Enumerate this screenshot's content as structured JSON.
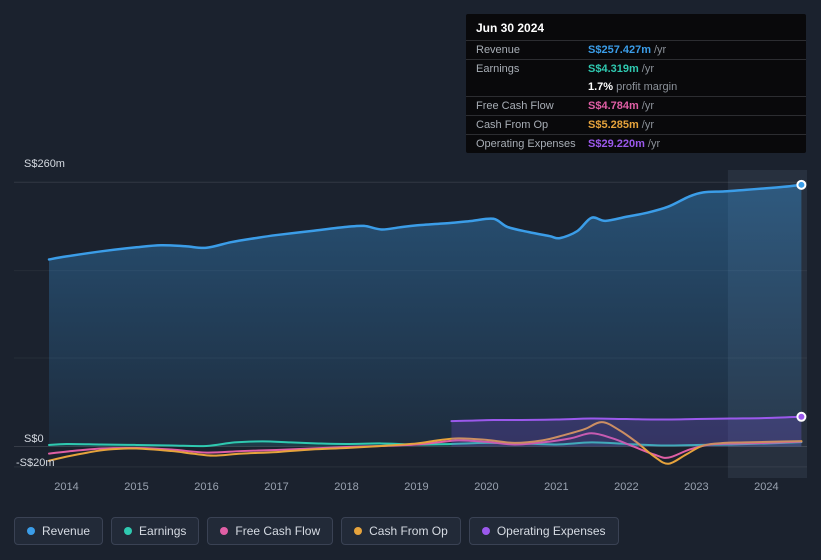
{
  "tooltip": {
    "date": "Jun 30 2024",
    "rows": {
      "revenue": {
        "label": "Revenue",
        "value": "S$257.427m",
        "suffix": "/yr"
      },
      "earnings": {
        "label": "Earnings",
        "value": "S$4.319m",
        "suffix": "/yr"
      },
      "margin": {
        "value": "1.7%",
        "suffix": "profit margin"
      },
      "fcf": {
        "label": "Free Cash Flow",
        "value": "S$4.784m",
        "suffix": "/yr"
      },
      "cash_op": {
        "label": "Cash From Op",
        "value": "S$5.285m",
        "suffix": "/yr"
      },
      "opex": {
        "label": "Operating Expenses",
        "value": "S$29.220m",
        "suffix": "/yr"
      }
    }
  },
  "chart_data": {
    "type": "line",
    "unit": "S$m",
    "xlim": [
      2013.25,
      2024.58
    ],
    "ylim": [
      -31,
      272
    ],
    "x_ticks": [
      2014,
      2015,
      2016,
      2017,
      2018,
      2019,
      2020,
      2021,
      2022,
      2023,
      2024
    ],
    "y_ticks": [
      {
        "label": "S$260m",
        "value": 260
      },
      {
        "label": "S$0",
        "value": 0
      },
      {
        "label": "-S$20m",
        "value": -20
      }
    ],
    "grid": [
      {
        "v": 260,
        "o": 0.1
      },
      {
        "v": 173,
        "o": 0.05
      },
      {
        "v": 87,
        "o": 0.05
      },
      {
        "v": 0,
        "o": 0.12
      },
      {
        "v": -20,
        "o": 0.07
      }
    ],
    "highlight": {
      "x0": 2023.45,
      "x1": 2024.58
    },
    "legend_position": "bottom",
    "series": [
      {
        "name": "Revenue",
        "slug": "revenue",
        "color": "#3b9de8",
        "width": 2.5,
        "fill": "gradient",
        "end_dot": true,
        "points": [
          [
            2013.75,
            184
          ],
          [
            2014,
            187
          ],
          [
            2014.5,
            192
          ],
          [
            2015,
            196
          ],
          [
            2015.35,
            198
          ],
          [
            2015.7,
            197
          ],
          [
            2016,
            195.5
          ],
          [
            2016.35,
            201
          ],
          [
            2016.7,
            205
          ],
          [
            2017,
            208
          ],
          [
            2017.5,
            212
          ],
          [
            2018,
            216
          ],
          [
            2018.25,
            217
          ],
          [
            2018.5,
            213.5
          ],
          [
            2018.75,
            215.5
          ],
          [
            2019,
            217.5
          ],
          [
            2019.5,
            220
          ],
          [
            2019.8,
            222
          ],
          [
            2020.1,
            224
          ],
          [
            2020.3,
            216
          ],
          [
            2020.6,
            211
          ],
          [
            2020.9,
            207
          ],
          [
            2021.05,
            205
          ],
          [
            2021.3,
            212
          ],
          [
            2021.5,
            225
          ],
          [
            2021.7,
            222
          ],
          [
            2022,
            226
          ],
          [
            2022.3,
            230
          ],
          [
            2022.6,
            236
          ],
          [
            2022.9,
            246
          ],
          [
            2023.1,
            250
          ],
          [
            2023.4,
            251
          ],
          [
            2023.7,
            252.5
          ],
          [
            2024,
            254
          ],
          [
            2024.25,
            255.5
          ],
          [
            2024.5,
            257.427
          ]
        ]
      },
      {
        "name": "Earnings",
        "slug": "earnings",
        "color": "#2fc9b0",
        "width": 2,
        "fill": "rgba(47,201,176,0.10)",
        "end_dot": false,
        "points": [
          [
            2013.75,
            1.5
          ],
          [
            2014,
            2.5
          ],
          [
            2014.5,
            2
          ],
          [
            2015,
            1.5
          ],
          [
            2015.5,
            1
          ],
          [
            2016,
            0.5
          ],
          [
            2016.4,
            4
          ],
          [
            2016.8,
            5
          ],
          [
            2017.2,
            4
          ],
          [
            2017.6,
            3
          ],
          [
            2018,
            2.5
          ],
          [
            2018.5,
            3
          ],
          [
            2019,
            2
          ],
          [
            2019.5,
            2.5
          ],
          [
            2020,
            3.5
          ],
          [
            2020.5,
            3
          ],
          [
            2021,
            2
          ],
          [
            2021.5,
            4
          ],
          [
            2022,
            2.5
          ],
          [
            2022.5,
            1
          ],
          [
            2023,
            1.5
          ],
          [
            2023.5,
            2
          ],
          [
            2024,
            3
          ],
          [
            2024.5,
            4.319
          ]
        ]
      },
      {
        "name": "Free Cash Flow",
        "slug": "free-cash-flow",
        "color": "#e05fa5",
        "width": 2,
        "fill": null,
        "end_dot": false,
        "points": [
          [
            2013.75,
            -7
          ],
          [
            2014,
            -5
          ],
          [
            2014.5,
            -2
          ],
          [
            2015,
            -1.5
          ],
          [
            2015.5,
            -3
          ],
          [
            2016,
            -6
          ],
          [
            2016.5,
            -4.5
          ],
          [
            2017,
            -3.5
          ],
          [
            2017.5,
            -2
          ],
          [
            2018,
            -0.5
          ],
          [
            2018.5,
            0.5
          ],
          [
            2019,
            2
          ],
          [
            2019.3,
            4
          ],
          [
            2019.6,
            6
          ],
          [
            2020,
            4.5
          ],
          [
            2020.4,
            2
          ],
          [
            2020.8,
            4
          ],
          [
            2021.2,
            8
          ],
          [
            2021.5,
            13
          ],
          [
            2021.8,
            8
          ],
          [
            2022.1,
            0
          ],
          [
            2022.4,
            -8
          ],
          [
            2022.6,
            -11
          ],
          [
            2022.9,
            -3
          ],
          [
            2023.2,
            2
          ],
          [
            2023.6,
            3
          ],
          [
            2024,
            3.5
          ],
          [
            2024.5,
            4.784
          ]
        ]
      },
      {
        "name": "Cash From Op",
        "slug": "cash-from-op",
        "color": "#e6a33c",
        "width": 2,
        "fill": null,
        "end_dot": false,
        "points": [
          [
            2013.75,
            -14
          ],
          [
            2014,
            -10
          ],
          [
            2014.3,
            -6
          ],
          [
            2014.6,
            -3
          ],
          [
            2015,
            -2
          ],
          [
            2015.5,
            -4.5
          ],
          [
            2015.8,
            -7
          ],
          [
            2016.1,
            -9
          ],
          [
            2016.5,
            -7
          ],
          [
            2017,
            -5.5
          ],
          [
            2017.5,
            -3
          ],
          [
            2018,
            -1.5
          ],
          [
            2018.5,
            0.5
          ],
          [
            2019,
            3
          ],
          [
            2019.3,
            6
          ],
          [
            2019.6,
            8
          ],
          [
            2020,
            6.5
          ],
          [
            2020.4,
            3.5
          ],
          [
            2020.8,
            6
          ],
          [
            2021.1,
            11
          ],
          [
            2021.4,
            17
          ],
          [
            2021.65,
            24
          ],
          [
            2021.9,
            16
          ],
          [
            2022.15,
            4
          ],
          [
            2022.4,
            -10
          ],
          [
            2022.6,
            -17
          ],
          [
            2022.85,
            -8
          ],
          [
            2023.1,
            1
          ],
          [
            2023.4,
            3.5
          ],
          [
            2023.7,
            4
          ],
          [
            2024,
            4.5
          ],
          [
            2024.5,
            5.285
          ]
        ]
      },
      {
        "name": "Operating Expenses",
        "slug": "operating-expenses",
        "color": "#9b59ec",
        "width": 2,
        "fill": "rgba(123,79,214,0.25)",
        "end_dot": true,
        "points": [
          [
            2019.5,
            25
          ],
          [
            2019.8,
            25.5
          ],
          [
            2020.1,
            26
          ],
          [
            2020.5,
            26
          ],
          [
            2021,
            26.5
          ],
          [
            2021.5,
            27.5
          ],
          [
            2022,
            27
          ],
          [
            2022.5,
            26.5
          ],
          [
            2023,
            27
          ],
          [
            2023.5,
            27.5
          ],
          [
            2024,
            28
          ],
          [
            2024.5,
            29.22
          ]
        ]
      }
    ]
  }
}
